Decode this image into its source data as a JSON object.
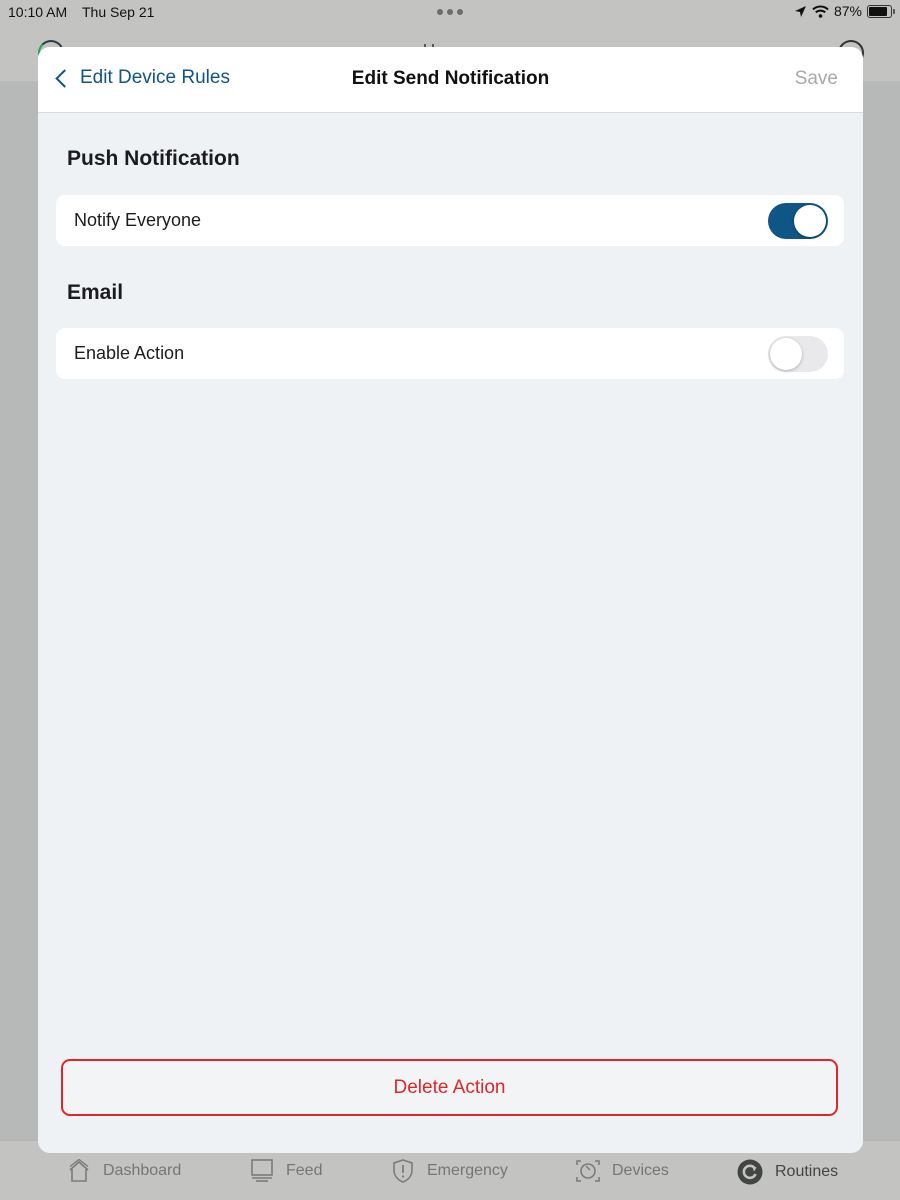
{
  "status_bar": {
    "time": "10:10 AM",
    "date": "Thu Sep 21",
    "battery_percent": "87%",
    "battery_level": 0.87,
    "icons": [
      "location-arrow-icon",
      "wifi-icon",
      "battery-icon"
    ]
  },
  "nav": {
    "back_label": "Edit Device Rules",
    "title": "Edit Send Notification",
    "save_label": "Save"
  },
  "sections": [
    {
      "title": "Push Notification",
      "rows": [
        {
          "label": "Notify Everyone",
          "toggle_on": true
        }
      ]
    },
    {
      "title": "Email",
      "rows": [
        {
          "label": "Enable Action",
          "toggle_on": false
        }
      ]
    }
  ],
  "delete_label": "Delete Action",
  "colors": {
    "accent": "#0f5585",
    "destructive": "#e0262a",
    "disabled": "#a8a9ab",
    "sheet_background": "#eff2f5"
  },
  "tabbar": {
    "items": [
      {
        "label": "Dashboard",
        "icon": "home-icon",
        "active": false
      },
      {
        "label": "Feed",
        "icon": "monitor-icon",
        "active": false
      },
      {
        "label": "Emergency",
        "icon": "shield-alert-icon",
        "active": false
      },
      {
        "label": "Devices",
        "icon": "camera-scan-icon",
        "active": false
      },
      {
        "label": "Routines",
        "icon": "routines-refresh-icon",
        "active": true
      }
    ]
  }
}
